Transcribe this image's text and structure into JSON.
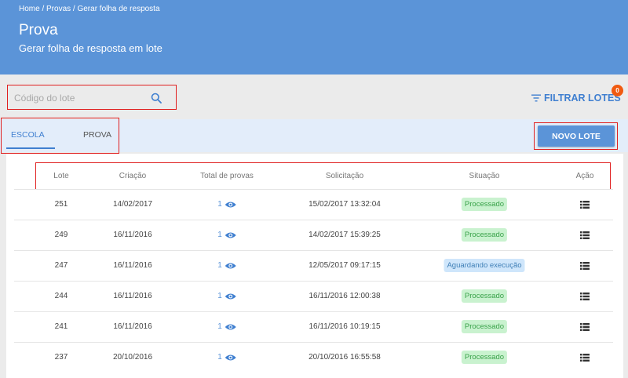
{
  "header": {
    "breadcrumb": "Home / Provas / Gerar folha de resposta",
    "title": "Prova",
    "subtitle": "Gerar folha de resposta em lote",
    "color": "#5b94d8"
  },
  "search": {
    "placeholder": "Código do lote",
    "icon": "search-icon"
  },
  "filter": {
    "label": "FILTRAR LOTES",
    "badge": "0",
    "icon": "filter-icon",
    "badge_color": "#f05a10"
  },
  "tabs": [
    {
      "label": "ESCOLA",
      "active": true
    },
    {
      "label": "PROVA",
      "active": false
    }
  ],
  "new_button": {
    "label": "NOVO LOTE"
  },
  "table": {
    "headers": [
      "Lote",
      "Criação",
      "Total de provas",
      "Solicitação",
      "Situação",
      "Ação"
    ],
    "rows": [
      {
        "lote": "251",
        "criacao": "14/02/2017",
        "total": "1",
        "solicitacao": "15/02/2017 13:32:04",
        "situacao": "Processado",
        "status_type": "success"
      },
      {
        "lote": "249",
        "criacao": "16/11/2016",
        "total": "1",
        "solicitacao": "14/02/2017 15:39:25",
        "situacao": "Processado",
        "status_type": "success"
      },
      {
        "lote": "247",
        "criacao": "16/11/2016",
        "total": "1",
        "solicitacao": "12/05/2017 09:17:15",
        "situacao": "Aguardando execução",
        "status_type": "pending"
      },
      {
        "lote": "244",
        "criacao": "16/11/2016",
        "total": "1",
        "solicitacao": "16/11/2016 12:00:38",
        "situacao": "Processado",
        "status_type": "success"
      },
      {
        "lote": "241",
        "criacao": "16/11/2016",
        "total": "1",
        "solicitacao": "16/11/2016 10:19:15",
        "situacao": "Processado",
        "status_type": "success"
      },
      {
        "lote": "237",
        "criacao": "20/10/2016",
        "total": "1",
        "solicitacao": "20/10/2016 16:55:58",
        "situacao": "Processado",
        "status_type": "success"
      }
    ]
  },
  "colors": {
    "accent": "#3f7fd0",
    "success_bg": "#c9f2cf",
    "pending_bg": "#cfe6fb"
  }
}
